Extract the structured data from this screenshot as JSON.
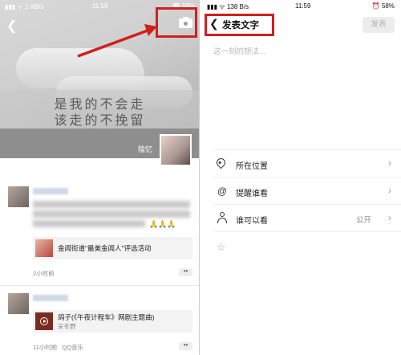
{
  "left": {
    "status": {
      "signal": "▮▮▮ ᯤ 1 KB/s",
      "time": "11:59",
      "battery": "☎ 58%"
    },
    "cover": {
      "poem_line1": "是我的不会走",
      "poem_line2": "该走的不挽留",
      "nickname": "陰忆"
    },
    "post1": {
      "link_title": "金阊街道\"最美金阊人\"评选活动",
      "time": "2小时前",
      "more": "••",
      "emojis": "🙏🙏🙏"
    },
    "post2": {
      "song_title": "鸽子(《午夜计程车》网剧主题曲)",
      "artist": "宋冬野",
      "time": "11小时前",
      "source": "QQ音乐",
      "more": "••"
    }
  },
  "right": {
    "status": {
      "signal": "▮▮▮ ᯤ 138 B/s",
      "time": "11:59",
      "battery": "⏰ 58%"
    },
    "title": "发表文字",
    "send_label": "发表",
    "placeholder": "这一刻的想法...",
    "options": [
      {
        "label": "所在位置",
        "value": "",
        "icon": "location-icon"
      },
      {
        "label": "提醒谁看",
        "value": "",
        "icon": "at-icon"
      },
      {
        "label": "谁可以看",
        "value": "公开",
        "icon": "person-icon"
      }
    ]
  },
  "colors": {
    "highlight": "#d0201d",
    "link": "#57627a"
  }
}
